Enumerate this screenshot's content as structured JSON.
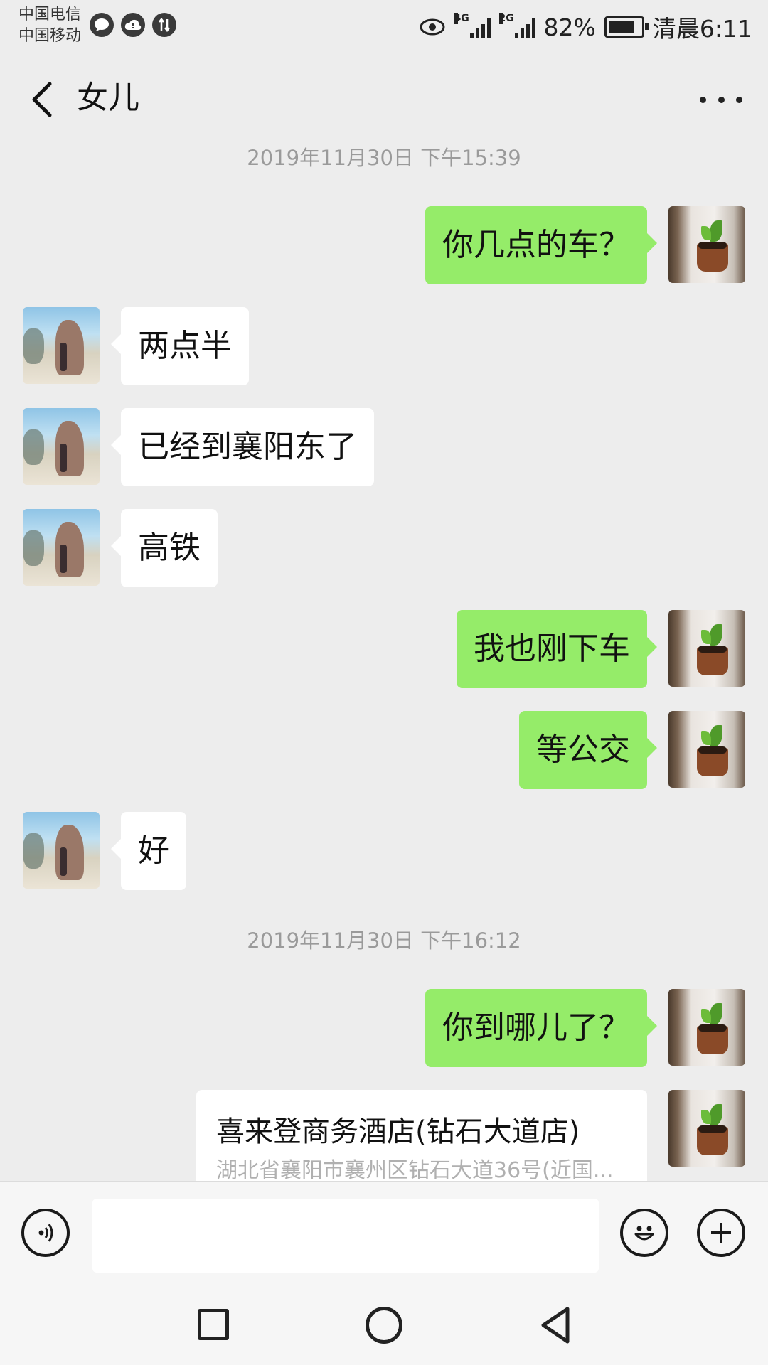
{
  "status_bar": {
    "carrier_1": "中国电信",
    "carrier_2": "中国移动",
    "left_icons": [
      "chat-bubble-icon",
      "cloud-alert-icon",
      "data-transfer-icon"
    ],
    "net_1": "4G",
    "net_2": "2G",
    "battery_percent": "82%",
    "battery_level": 0.82,
    "time": "清晨6:11"
  },
  "header": {
    "title": "女儿"
  },
  "messages": [
    {
      "type": "timestamp",
      "text": "2019年11月30日 下午15:39"
    },
    {
      "type": "text",
      "from": "me",
      "text": "你几点的车？"
    },
    {
      "type": "text",
      "from": "her",
      "text": "两点半"
    },
    {
      "type": "text",
      "from": "her",
      "text": "已经到襄阳东了"
    },
    {
      "type": "text",
      "from": "her",
      "text": "高铁"
    },
    {
      "type": "text",
      "from": "me",
      "text": "我也刚下车"
    },
    {
      "type": "text",
      "from": "me",
      "text": "等公交"
    },
    {
      "type": "text",
      "from": "her",
      "text": "好"
    },
    {
      "type": "timestamp",
      "text": "2019年11月30日 下午16:12"
    },
    {
      "type": "text",
      "from": "me",
      "text": "你到哪儿了？"
    },
    {
      "type": "location",
      "from": "me",
      "name": "喜来登商务酒店(钻石大道店)",
      "address": "湖北省襄阳市襄州区钻石大道36号(近国..."
    }
  ],
  "input_bar": {
    "value": "",
    "placeholder": ""
  },
  "colors": {
    "background": "#ededed",
    "my_bubble": "#95ec69",
    "her_bubble": "#ffffff",
    "timestamp": "#9a9a9a"
  }
}
